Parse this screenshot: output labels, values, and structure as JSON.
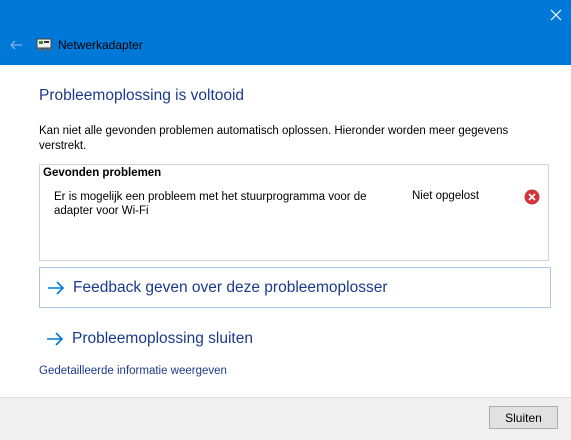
{
  "window": {
    "title": "Netwerkadapter"
  },
  "page": {
    "heading": "Probleemoplossing is voltooid",
    "description": "Kan niet alle gevonden problemen automatisch oplossen. Hieronder worden meer gegevens verstrekt."
  },
  "problems": {
    "header": "Gevonden problemen",
    "items": [
      {
        "text": "Er is mogelijk een probleem met het stuurprogramma voor de adapter voor Wi-Fi",
        "status": "Niet opgelost",
        "status_icon": "error-icon"
      }
    ]
  },
  "actions": {
    "feedback_label": "Feedback geven over deze probleemoplosser",
    "close_label": "Probleemoplossing sluiten",
    "details_link": "Gedetailleerde informatie weergeven"
  },
  "footer": {
    "close_button": "Sluiten"
  },
  "colors": {
    "titlebar": "#0078d7",
    "link": "#1b3a8c",
    "accent_arrow": "#0078d7",
    "error": "#d13438"
  }
}
